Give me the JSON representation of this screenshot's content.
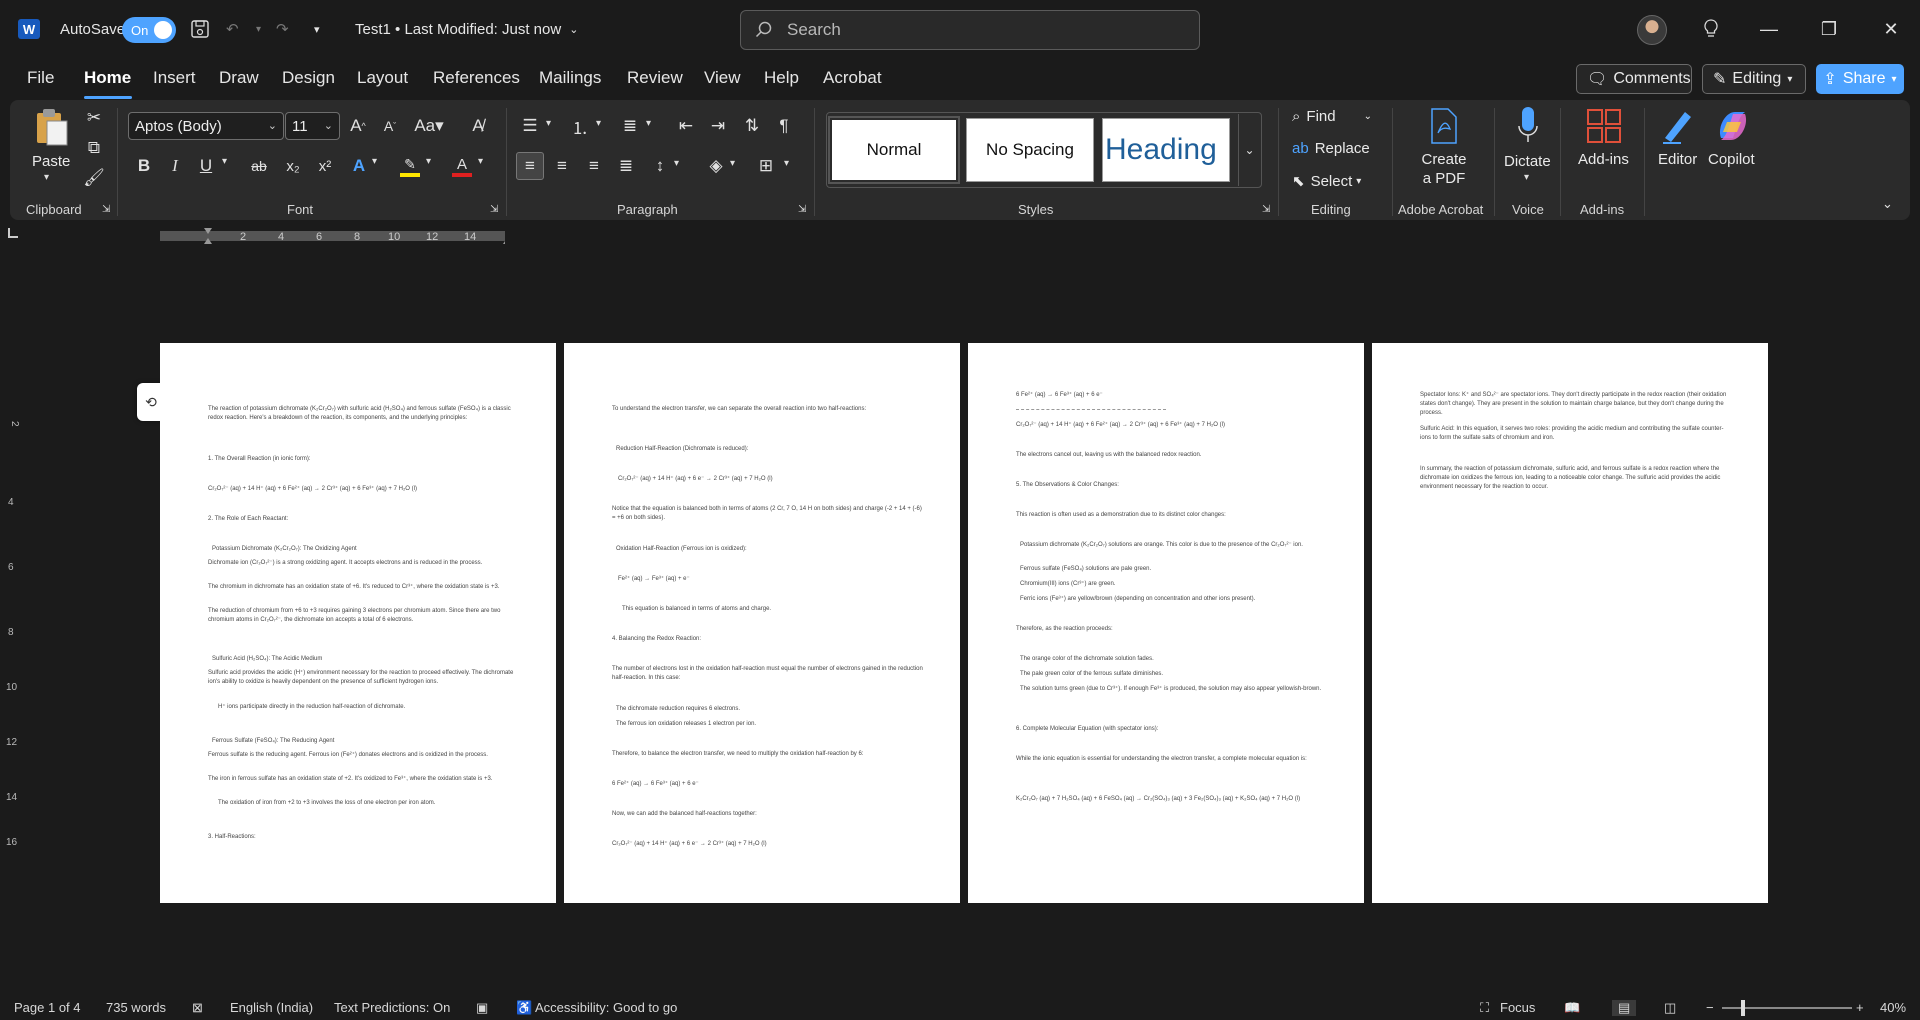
{
  "titlebar": {
    "app_letter": "W",
    "autosave_label": "AutoSave",
    "autosave_state": "On",
    "doc_title": "Test1 • Last Modified: Just now",
    "search_placeholder": "Search"
  },
  "menu": {
    "items": [
      "File",
      "Home",
      "Insert",
      "Draw",
      "Design",
      "Layout",
      "References",
      "Mailings",
      "Review",
      "View",
      "Help",
      "Acrobat"
    ],
    "comments_label": "Comments",
    "editing_label": "Editing",
    "share_label": "Share"
  },
  "ribbon": {
    "paste_label": "Paste",
    "font_name": "Aptos (Body)",
    "font_size": "11",
    "groups": {
      "clipboard": "Clipboard",
      "font": "Font",
      "paragraph": "Paragraph",
      "styles": "Styles",
      "editing": "Editing",
      "adobe": "Adobe Acrobat",
      "voice": "Voice",
      "addins": "Add-ins"
    },
    "styles": [
      "Normal",
      "No Spacing",
      "Heading"
    ],
    "find_label": "Find",
    "replace_label": "Replace",
    "select_label": "Select",
    "create_pdf_label": "Create a PDF",
    "dictate_label": "Dictate",
    "addins_label": "Add-ins",
    "editor_label": "Editor",
    "copilot_label": "Copilot"
  },
  "pages": {
    "page1": [
      "The reaction of potassium dichromate (K₂Cr₂O₇) with sulfuric acid (H₂SO₄) and ferrous sulfate (FeSO₄) is a classic redox reaction. Here's a breakdown of the reaction, its components, and the underlying principles:",
      "1. The Overall Reaction (in ionic form):",
      "Cr₂O₇²⁻ (aq) + 14 H⁺ (aq) + 6 Fe²⁺ (aq) → 2 Cr³⁺ (aq) + 6 Fe³⁺ (aq) + 7 H₂O (l)",
      "2. The Role of Each Reactant:",
      "Potassium Dichromate (K₂Cr₂O₇): The Oxidizing Agent",
      "Dichromate ion (Cr₂O₇²⁻) is a strong oxidizing agent. It accepts electrons and is reduced in the process.",
      "The chromium in dichromate has an oxidation state of +6. It's reduced to Cr³⁺, where the oxidation state is +3.",
      "The reduction of chromium from +6 to +3 requires gaining 3 electrons per chromium atom. Since there are two chromium atoms in Cr₂O₇²⁻, the dichromate ion accepts a total of 6 electrons.",
      "Sulfuric Acid (H₂SO₄): The Acidic Medium",
      "Sulfuric acid provides the acidic (H⁺) environment necessary for the reaction to proceed effectively. The dichromate ion's ability to oxidize is heavily dependent on the presence of sufficient hydrogen ions.",
      "H⁺ ions participate directly in the reduction half-reaction of dichromate.",
      "Ferrous Sulfate (FeSO₄): The Reducing Agent",
      "Ferrous sulfate is the reducing agent. Ferrous ion (Fe²⁺) donates electrons and is oxidized in the process.",
      "The iron in ferrous sulfate has an oxidation state of +2. It's oxidized to Fe³⁺, where the oxidation state is +3.",
      "The oxidation of iron from +2 to +3 involves the loss of one electron per iron atom.",
      "3. Half-Reactions:"
    ],
    "page2": [
      "To understand the electron transfer, we can separate the overall reaction into two half-reactions:",
      "Reduction Half-Reaction (Dichromate is reduced):",
      "Cr₂O₇²⁻ (aq) + 14 H⁺ (aq) + 6 e⁻ → 2 Cr³⁺ (aq) + 7 H₂O (l)",
      "Notice that the equation is balanced both in terms of atoms (2 Cr, 7 O, 14 H on both sides) and charge (-2 + 14 + (-6) = +6 on both sides).",
      "Oxidation Half-Reaction (Ferrous ion is oxidized):",
      "Fe²⁺ (aq) → Fe³⁺ (aq) + e⁻",
      "This equation is balanced in terms of atoms and charge.",
      "4. Balancing the Redox Reaction:",
      "The number of electrons lost in the oxidation half-reaction must equal the number of electrons gained in the reduction half-reaction. In this case:",
      "The dichromate reduction requires 6 electrons.",
      "The ferrous ion oxidation releases 1 electron per ion.",
      "Therefore, to balance the electron transfer, we need to multiply the oxidation half-reaction by 6:",
      "6 Fe²⁺ (aq) → 6 Fe³⁺ (aq) + 6 e⁻",
      "Now, we can add the balanced half-reactions together:",
      "Cr₂O₇²⁻ (aq) + 14 H⁺ (aq) + 6 e⁻ → 2 Cr³⁺ (aq) + 7 H₂O (l)"
    ],
    "page3": [
      "6 Fe²⁺ (aq) → 6 Fe³⁺ (aq) + 6 e⁻",
      "Cr₂O₇²⁻ (aq) + 14 H⁺ (aq) + 6 Fe²⁺ (aq) → 2 Cr³⁺ (aq) + 6 Fe³⁺ (aq) + 7 H₂O (l)",
      "The electrons cancel out, leaving us with the balanced redox reaction.",
      "5. The Observations & Color Changes:",
      "This reaction is often used as a demonstration due to its distinct color changes:",
      "Potassium dichromate (K₂Cr₂O₇) solutions are orange. This color is due to the presence of the Cr₂O₇²⁻ ion.",
      "Ferrous sulfate (FeSO₄) solutions are pale green.",
      "Chromium(III) ions (Cr³⁺) are green.",
      "Ferric ions (Fe³⁺) are yellow/brown (depending on concentration and other ions present).",
      "Therefore, as the reaction proceeds:",
      "The orange color of the dichromate solution fades.",
      "The pale green color of the ferrous sulfate diminishes.",
      "The solution turns green (due to Cr³⁺). If enough Fe³⁺ is produced, the solution may also appear yellowish-brown.",
      "6. Complete Molecular Equation (with spectator ions):",
      "While the ionic equation is essential for understanding the electron transfer, a complete molecular equation is:",
      "K₂Cr₂O₇ (aq) + 7 H₂SO₄ (aq) + 6 FeSO₄ (aq) → Cr₂(SO₄)₃ (aq) + 3 Fe₂(SO₄)₃ (aq) + K₂SO₄ (aq) + 7 H₂O (l)"
    ],
    "page4": [
      "Spectator Ions: K⁺ and SO₄²⁻ are spectator ions. They don't directly participate in the redox reaction (their oxidation states don't change). They are present in the solution to maintain charge balance, but they don't change during the process.",
      "Sulfuric Acid: In this equation, it serves two roles: providing the acidic medium and contributing the sulfate counter-ions to form the sulfate salts of chromium and iron.",
      "In summary, the reaction of potassium dichromate, sulfuric acid, and ferrous sulfate is a redox reaction where the dichromate ion oxidizes the ferrous ion, leading to a noticeable color change. The sulfuric acid provides the acidic environment necessary for the reaction to occur."
    ]
  },
  "status": {
    "page": "Page 1 of 4",
    "words": "735 words",
    "language": "English (India)",
    "text_predictions": "Text Predictions: On",
    "accessibility": "Accessibility: Good to go",
    "focus": "Focus",
    "zoom": "40%"
  },
  "colors": {
    "accent": "#4ea3ff",
    "word_blue": "#185abd",
    "background": "#1b1b1b",
    "ribbon": "#2b2b2b"
  }
}
